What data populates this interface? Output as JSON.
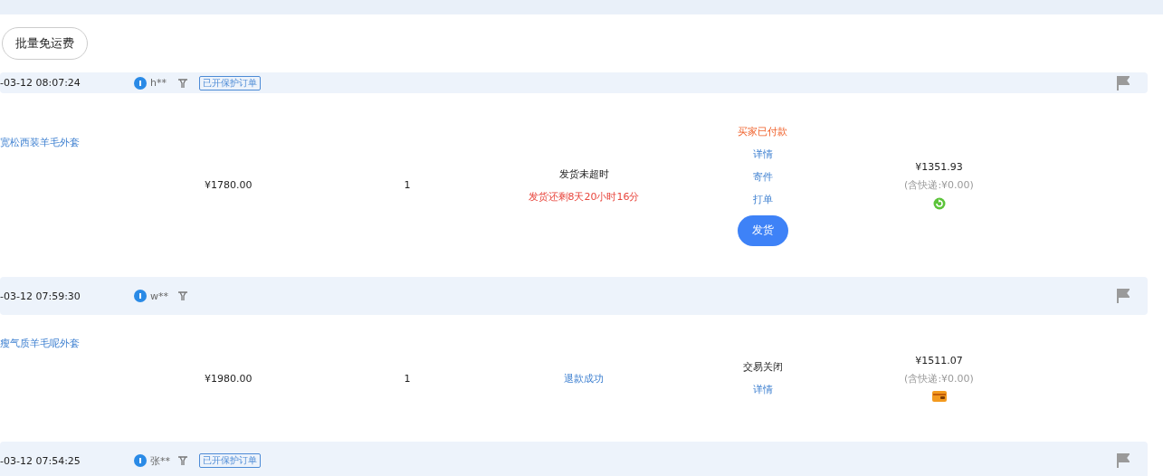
{
  "toolbar": {
    "button": "批量免运费"
  },
  "orders": [
    {
      "time": "-03-12 08:07:24",
      "buyer": "h**",
      "tag": "已开保护订单",
      "item": "宽松西装羊毛外套",
      "price": "¥1780.00",
      "quantity": "1",
      "status": {
        "kind": "pending",
        "title": "发货未超时",
        "note": "发货还剩8天20小时16分"
      },
      "trade_state": "买家已付款",
      "links": [
        "详情",
        "寄件",
        "打单"
      ],
      "ship_button": "发货",
      "total": "¥1351.93",
      "shipping": "(含快递:¥0.00)",
      "payment_icon": {
        "kind": "refresh"
      }
    },
    {
      "time": "-03-12 07:59:30",
      "buyer": "w**",
      "item": "瘦气质羊毛呢外套",
      "price": "¥1980.00",
      "quantity": "1",
      "status": {
        "kind": "refund",
        "title": "退款成功"
      },
      "trade_state": "交易关闭",
      "links": [
        "详情"
      ],
      "total": "¥1511.07",
      "shipping": "(含快递:¥0.00)",
      "payment_icon": {
        "kind": "wallet"
      }
    },
    {
      "time": "-03-12 07:54:25",
      "buyer": "张**",
      "tag": "已开保护订单"
    }
  ]
}
